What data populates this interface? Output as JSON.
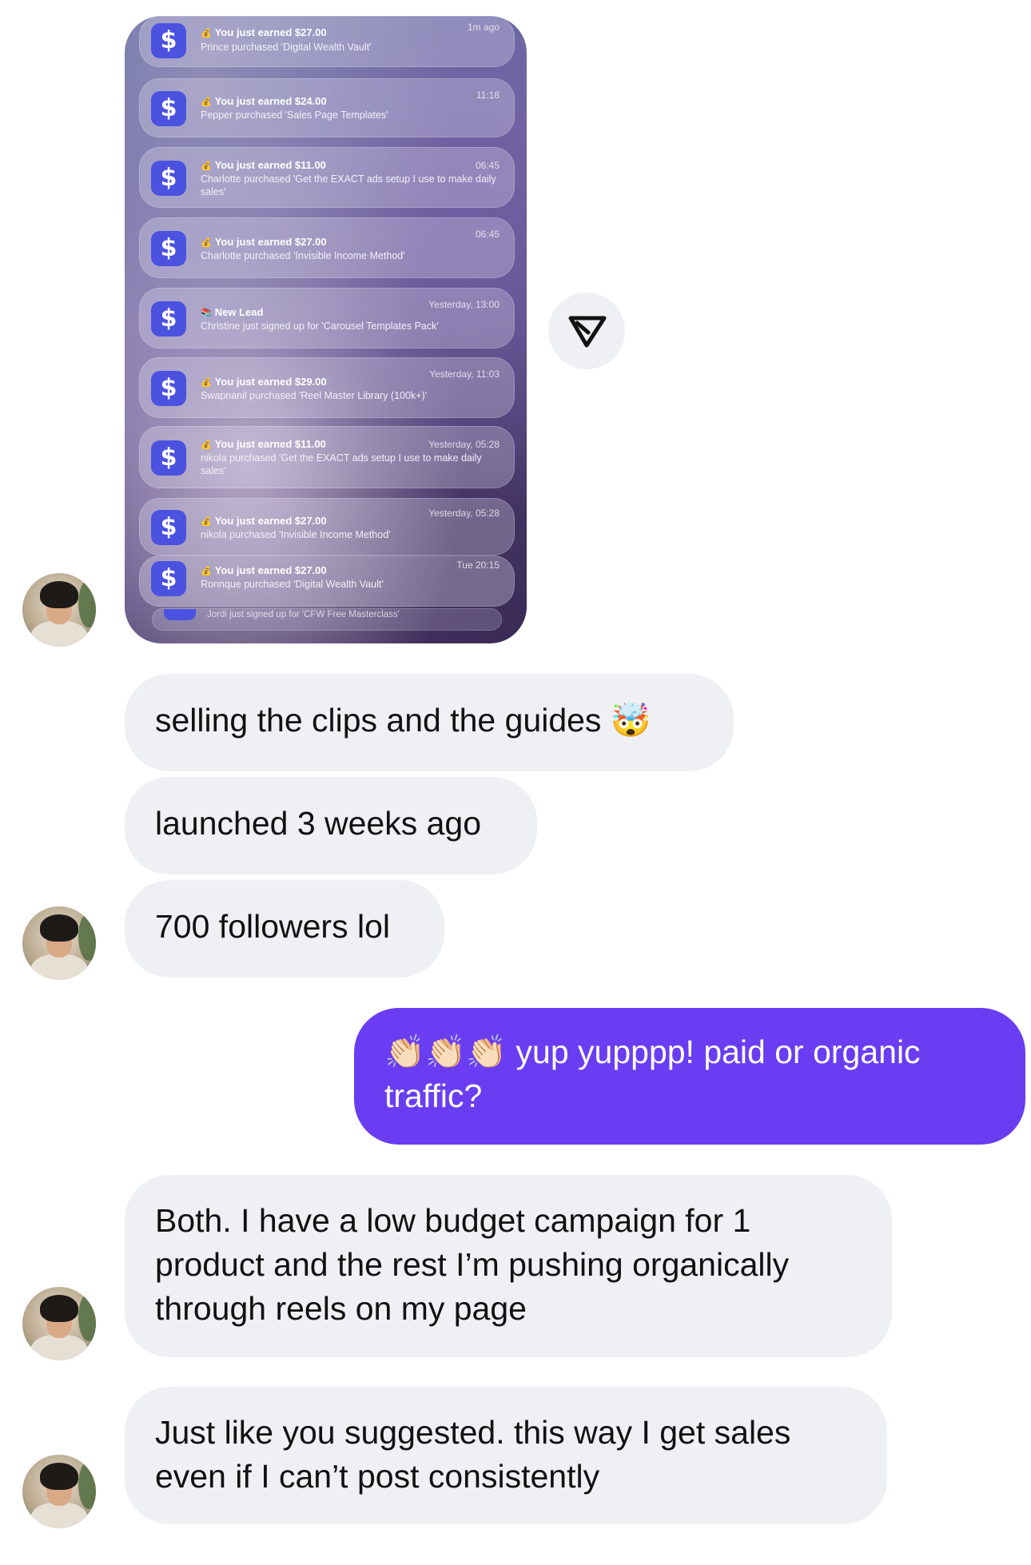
{
  "screenshot": {
    "notifications": [
      {
        "icon": "dollar-icon",
        "emoji": "💰",
        "title": "You just earned $27.00",
        "body": "Prince purchased 'Digital Wealth Vault'",
        "time": "1m ago"
      },
      {
        "icon": "dollar-icon",
        "emoji": "💰",
        "title": "You just earned $24.00",
        "body": "Pepper purchased 'Sales Page Templates'",
        "time": "11:18"
      },
      {
        "icon": "dollar-icon",
        "emoji": "💰",
        "title": "You just earned $11.00",
        "body": "Charlotte purchased 'Get the EXACT ads setup I use to make daily sales'",
        "time": "06:45"
      },
      {
        "icon": "dollar-icon",
        "emoji": "💰",
        "title": "You just earned $27.00",
        "body": "Charlotte purchased 'Invisible Income Method'",
        "time": "06:45"
      },
      {
        "icon": "dollar-icon",
        "emoji": "📚",
        "title": "New Lead",
        "body": "Christine just signed up for 'Carousel Templates Pack'",
        "time": "Yesterday, 13:00"
      },
      {
        "icon": "dollar-icon",
        "emoji": "💰",
        "title": "You just earned $29.00",
        "body": "Swapnanil purchased 'Reel Master Library (100k+)'",
        "time": "Yesterday, 11:03"
      },
      {
        "icon": "dollar-icon",
        "emoji": "💰",
        "title": "You just earned $11.00",
        "body": "nikola purchased 'Get the EXACT ads setup I use to make daily sales'",
        "time": "Yesterday, 05:28"
      },
      {
        "icon": "dollar-icon",
        "emoji": "💰",
        "title": "You just earned $27.00",
        "body": "nikola purchased 'Invisible Income Method'",
        "time": "Yesterday, 05:28"
      },
      {
        "icon": "dollar-icon",
        "emoji": "💰",
        "title": "You just earned $27.00",
        "body": "Ronnque purchased 'Digital Wealth Vault'",
        "time": "Tue 20:15"
      }
    ],
    "stacked_peek_text": "Jordi just signed up for 'CFW Free Masterclass'"
  },
  "share_button": {
    "icon": "send-icon"
  },
  "messages": [
    {
      "direction": "received",
      "text": "selling the clips and the guides 🤯"
    },
    {
      "direction": "received",
      "text": "launched 3 weeks ago"
    },
    {
      "direction": "received",
      "text": "700 followers lol"
    },
    {
      "direction": "sent",
      "text": "👏🏻👏🏻👏🏻 yup yupppp! paid or organic traffic?"
    },
    {
      "direction": "received",
      "lines": [
        "Both. I have a low budget campaign for 1",
        "product and the rest I’m pushing organically",
        "through reels on my page"
      ]
    },
    {
      "direction": "received",
      "lines": [
        "Just like you suggested. this way I get sales",
        "even if I can’t post consistently"
      ]
    }
  ],
  "colors": {
    "received_bubble": "#eff0f3",
    "sent_bubble": "#6a3df2",
    "notification_icon": "#4b52e0"
  }
}
